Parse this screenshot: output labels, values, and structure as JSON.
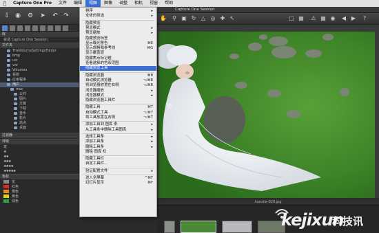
{
  "menubar": {
    "apple": "",
    "items": [
      "Capture One Pro",
      "文件",
      "编辑",
      "视图",
      "图像",
      "调整",
      "相机",
      "视窗",
      "帮助"
    ],
    "active_index": 3
  },
  "right_title": "Capture One Session",
  "panel": {
    "library_header": "库",
    "session_label": "会话 Capture One Session",
    "folder_header": "文件夹",
    "folders": [
      {
        "label": "TheVolumeSettingsFolder",
        "indent": 2
      },
      {
        "label": "bmp",
        "indent": 2
      },
      {
        "label": "usr",
        "indent": 2
      },
      {
        "label": "var",
        "indent": 2
      },
      {
        "label": "Volumes",
        "indent": 2
      },
      {
        "label": "系统",
        "indent": 2
      },
      {
        "label": "应用程序",
        "indent": 2
      },
      {
        "label": "用户",
        "indent": 2,
        "selected": true
      },
      {
        "label": "mac",
        "indent": 3
      },
      {
        "label": "公共",
        "indent": 4
      },
      {
        "label": "图片",
        "indent": 4
      },
      {
        "label": "文稿",
        "indent": 4
      },
      {
        "label": "下载",
        "indent": 4
      },
      {
        "label": "音乐",
        "indent": 4
      },
      {
        "label": "影片",
        "indent": 4
      },
      {
        "label": "站点",
        "indent": 4
      },
      {
        "label": "桌面",
        "indent": 4
      }
    ],
    "filter_header": "过滤器",
    "rating_header": "评级",
    "ratings": [
      "无",
      "★",
      "★★",
      "★★★",
      "★★★★",
      "★★★★★"
    ],
    "color_header": "色标",
    "colors": [
      {
        "label": "无",
        "hex": "#8a8a8a"
      },
      {
        "label": "红色",
        "hex": "#d02a2a"
      },
      {
        "label": "橙色",
        "hex": "#e88a1a"
      },
      {
        "label": "黄色",
        "hex": "#e0d020"
      },
      {
        "label": "绿色",
        "hex": "#30a040"
      }
    ]
  },
  "menu": {
    "items": [
      {
        "label": "排序",
        "arrow": true
      },
      {
        "label": "全体的筛选",
        "arrow": true
      },
      {
        "sep": true
      },
      {
        "label": "隐藏预览"
      },
      {
        "label": "预览模式",
        "arrow": true
      },
      {
        "label": "预览缩放",
        "arrow": true
      },
      {
        "label": "隐藏预览标签"
      },
      {
        "label": "显示曝光警告",
        "sc": "⌘E"
      },
      {
        "label": "显示规格和参考线",
        "sc": "⌘G"
      },
      {
        "label": "显示覆盖层"
      },
      {
        "label": "隐藏焦点标记框"
      },
      {
        "label": "查看选择的色彩范围"
      },
      {
        "label": "隐藏预览工具",
        "hl": true
      },
      {
        "sep": true
      },
      {
        "label": "隐藏浏览器",
        "sc": "⌘B"
      },
      {
        "label": "自动模式浏览器",
        "sc": "⌥⌘B"
      },
      {
        "label": "将浏览器放置在右侧",
        "sc": "⌥⌘B"
      },
      {
        "label": "浏览器缩放",
        "arrow": true
      },
      {
        "label": "浏览器模式",
        "arrow": true
      },
      {
        "label": "隐藏浏览器工具栏"
      },
      {
        "sep": true
      },
      {
        "label": "隐藏工具",
        "sc": "⌘T"
      },
      {
        "label": "自动模式工具",
        "sc": "⌥⌘T"
      },
      {
        "label": "将工具放置在右侧",
        "sc": "⌥⌘T"
      },
      {
        "sep": true
      },
      {
        "label": "添加工具到 图库 条",
        "arrow": true
      },
      {
        "label": "从工具条中删除工具图库",
        "arrow": true
      },
      {
        "sep": true
      },
      {
        "label": "选择工具条",
        "arrow": true
      },
      {
        "label": "添加工具条",
        "arrow": true
      },
      {
        "label": "删除工具条",
        "arrow": true
      },
      {
        "label": "删除 图库 栏"
      },
      {
        "sep": true
      },
      {
        "label": "隐藏工具栏"
      },
      {
        "label": "自定工具栏..."
      },
      {
        "sep": true
      },
      {
        "label": "验证配置文件",
        "arrow": true
      },
      {
        "sep": true
      },
      {
        "label": "进入全屏幕",
        "sc": "^⌘F"
      },
      {
        "label": "幻灯片显示",
        "sc": "⌘F"
      }
    ]
  },
  "viewer": {
    "filename": "hunsha-020.jpg"
  },
  "watermark": {
    "brand": "kejixun",
    "cn": "科技讯"
  }
}
